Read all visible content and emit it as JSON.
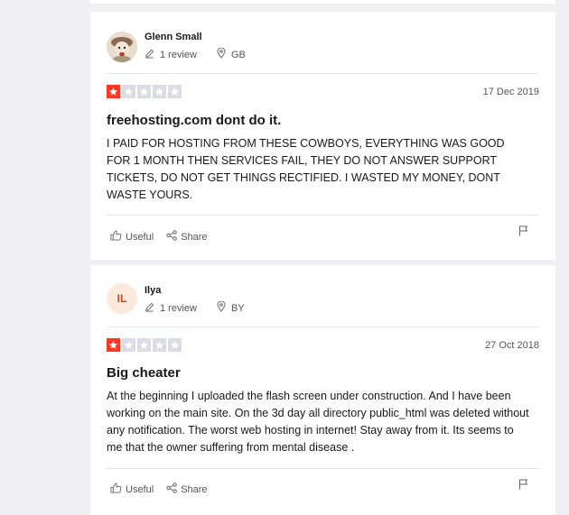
{
  "reviews": [
    {
      "reviewer": {
        "name": "Glenn Small",
        "review_count": "1 review",
        "country": "GB",
        "avatar_type": "photo"
      },
      "rating": 1,
      "date": "17 Dec 2019",
      "title": "freehosting.com dont do it.",
      "body": "I PAID FOR HOSTING FROM THESE COWBOYS, EVERYTHING WAS GOOD FOR 1 MONTH THEN SERVICES FAIL, THEY DO NOT ANSWER SUPPORT TICKETS, DO NOT GET THINGS RECTIFIED. I WASTED MY MONEY, DONT WASTE YOURS.",
      "useful_label": "Useful",
      "share_label": "Share"
    },
    {
      "reviewer": {
        "name": "Ilya",
        "initials": "IL",
        "review_count": "1 review",
        "country": "BY",
        "avatar_type": "initials"
      },
      "rating": 1,
      "date": "27 Oct 2018",
      "title": "Big cheater",
      "body": "At the beginning I uploaded the flash screen under construction. And I have been working on the main site. On the 3d day all directory public_html was deleted without any notification. The worst web hosting in internet! Stay away from it. Its seems to me that the owner suffering from mental disease .",
      "useful_label": "Useful",
      "share_label": "Share"
    }
  ],
  "colors": {
    "star_on": "#ff3722",
    "star_off": "#dcdce6",
    "page_bg": "#f0f0f3",
    "card_bg": "#ffffff"
  },
  "icons": [
    "pencil-icon",
    "location-pin-icon",
    "star-icon",
    "thumbs-up-icon",
    "share-icon",
    "flag-icon"
  ]
}
